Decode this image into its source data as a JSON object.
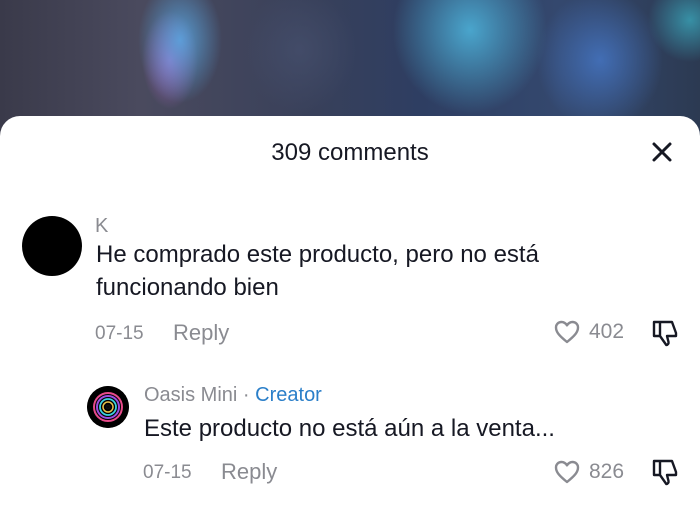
{
  "header": {
    "title": "309 comments"
  },
  "comments": [
    {
      "author": "K",
      "text_line1": "He comprado este producto, pero no está",
      "text_line2": "funcionando bien",
      "date": "07-15",
      "reply_label": "Reply",
      "likes": "402"
    }
  ],
  "replies": [
    {
      "author": "Oasis Mini",
      "separator": "·",
      "badge": "Creator",
      "text": "Este producto no está aún a la venta...",
      "date": "07-15",
      "reply_label": "Reply",
      "likes": "826"
    }
  ],
  "icons": {
    "close": "close-icon",
    "like": "heart-icon",
    "dislike": "thumbs-down-icon"
  },
  "colors": {
    "text_primary": "#161823",
    "text_secondary": "#8a8b91",
    "creator_accent": "#2b7fc9"
  }
}
